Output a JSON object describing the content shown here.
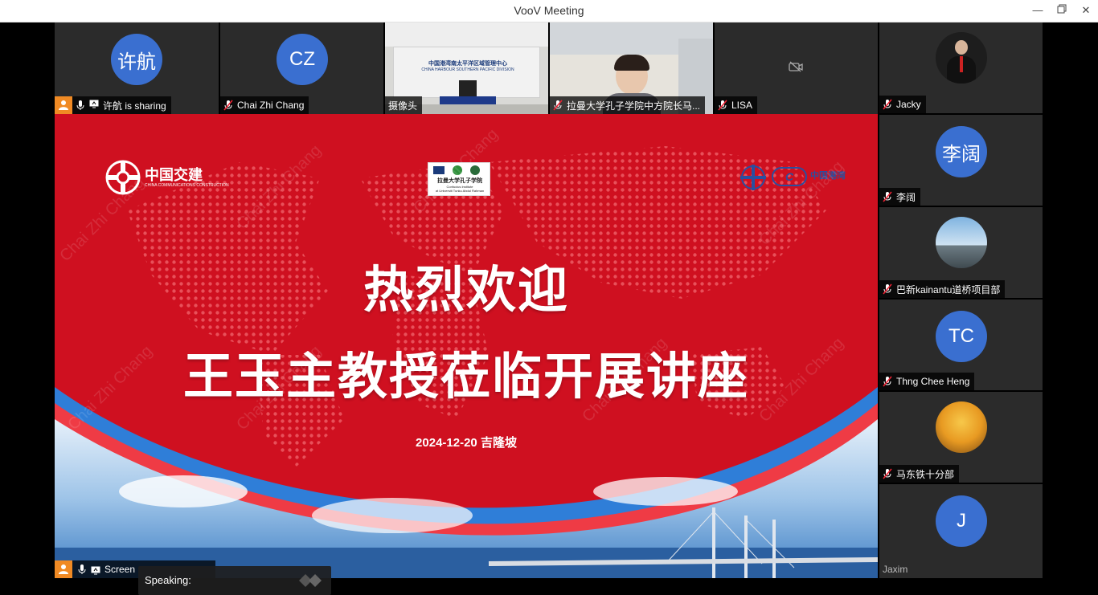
{
  "window": {
    "title": "VooV Meeting",
    "min_icon": "minimize-icon",
    "restore_icon": "restore-icon",
    "close_icon": "close-icon"
  },
  "top_tiles": [
    {
      "name": "许航 is sharing",
      "initials": "许航",
      "type": "avatar"
    },
    {
      "name": "Chai Zhi Chang",
      "initials": "CZ",
      "type": "avatar"
    },
    {
      "name": "摄像头",
      "type": "video",
      "backdrop_line1": "中国港湾南太平洋区域管理中心",
      "backdrop_line2": "CHINA HARBOUR SOUTHERN PACIFIC DIVISION"
    },
    {
      "name": "拉曼大学孔子学院中方院长马...",
      "type": "video"
    },
    {
      "name": "LISA",
      "type": "camera-off"
    }
  ],
  "side_tiles": [
    {
      "name": "Jacky",
      "type": "photo"
    },
    {
      "name": "李阔",
      "initials": "李阔",
      "type": "avatar"
    },
    {
      "name": "巴新kainantu道桥项目部",
      "type": "photo"
    },
    {
      "name": "Thng Chee Heng",
      "initials": "TC",
      "type": "avatar"
    },
    {
      "name": "马东铁十分部",
      "type": "photo"
    },
    {
      "name": "Jaxim",
      "initials": "J",
      "type": "avatar"
    }
  ],
  "slide": {
    "logo_left": "中国交建",
    "logo_left_sub": "CHINA COMMUNICATIONS CONSTRUCTION",
    "logo_center": "拉曼大学孔子学院",
    "logo_center_sub1": "Confucius Institute",
    "logo_center_sub2": "at Universiti Tunku Abdul Rahman",
    "logo_right": "中国港湾",
    "headline1": "热烈欢迎",
    "headline2": "王玉主教授莅临开展讲座",
    "date_line": "2024-12-20 吉隆坡",
    "watermark": "Chai Zhi Chang"
  },
  "bottom_bar": {
    "self_label": "Screen"
  },
  "speaking": {
    "label": "Speaking:"
  },
  "colors": {
    "accent": "#3a6fd0",
    "slide_red": "#cf1020",
    "badge_orange": "#f08a24"
  }
}
